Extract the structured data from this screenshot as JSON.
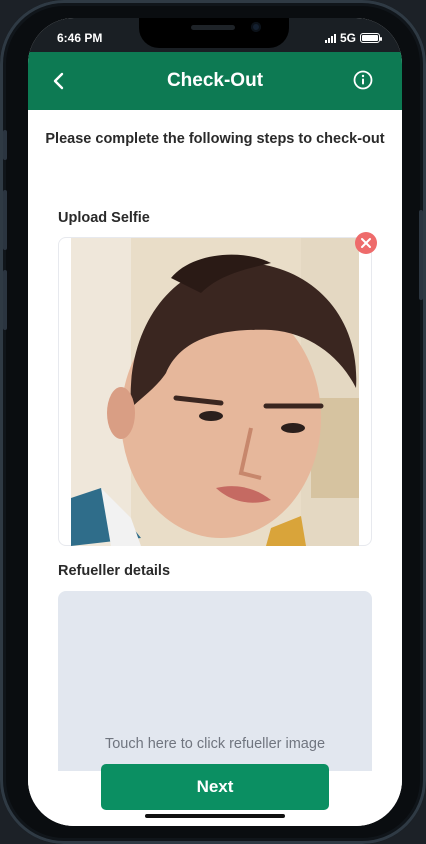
{
  "status_bar": {
    "time": "6:46 PM",
    "network": "5G",
    "battery_level": 1.0
  },
  "header": {
    "title": "Check-Out",
    "back_icon": "chevron-left-icon",
    "info_icon": "info-circle-icon",
    "color": "#0d7a53"
  },
  "instructions": "Please complete the following steps to check-out",
  "selfie": {
    "label": "Upload Selfie",
    "remove_icon": "close-icon",
    "remove_color": "#ee6b6b"
  },
  "refueller": {
    "label": "Refueller details",
    "placeholder_text": "Touch here to click refueller image"
  },
  "actions": {
    "next_label": "Next",
    "next_color": "#0b8f62"
  }
}
